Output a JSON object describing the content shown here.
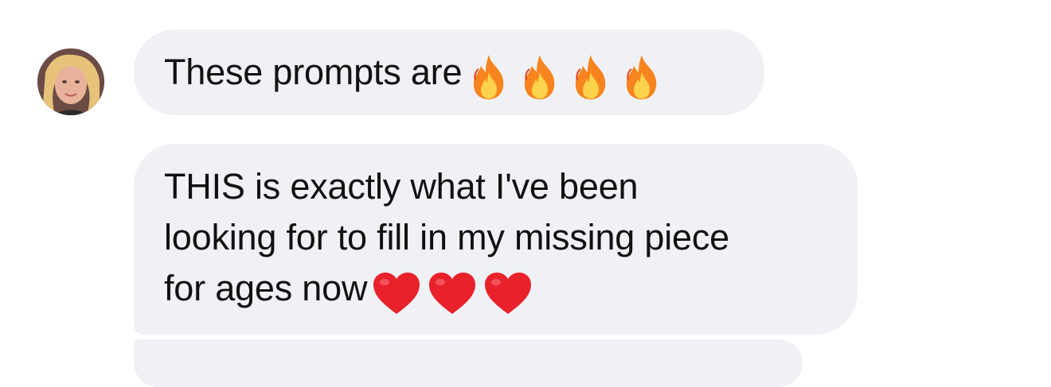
{
  "thread": {
    "messages": [
      {
        "text": "These prompts are",
        "emoji": [
          "fire-emoji",
          "fire-emoji",
          "fire-emoji",
          "fire-emoji"
        ]
      },
      {
        "lines": [
          "THIS is exactly what I've been",
          "looking for to fill in my missing piece",
          "for ages now"
        ],
        "emoji": [
          "red-heart-emoji",
          "red-heart-emoji",
          "red-heart-emoji"
        ]
      }
    ]
  },
  "colors": {
    "bubble": "#f0f1f5",
    "text": "#111111",
    "heart": "#e8212a",
    "fire_outer": "#f7841e",
    "fire_inner": "#fcd34b"
  }
}
